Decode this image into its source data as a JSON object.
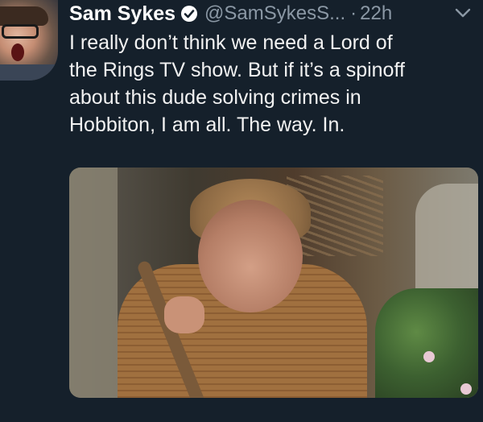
{
  "tweet": {
    "display_name": "Sam Sykes",
    "handle": "@SamSykesS...",
    "separator": "·",
    "time": "22h",
    "text": "I really don’t think we need a Lord of\nthe Rings TV show. But if it’s a spinoff\nabout this dude solving crimes in\nHobbiton, I am all. The way. In.",
    "verified": true,
    "icons": {
      "verified": "verified-badge-icon",
      "menu": "chevron-down-icon"
    }
  },
  "colors": {
    "background": "#15202b",
    "secondary_text": "#8b98a5",
    "primary_text": "#ffffff"
  }
}
